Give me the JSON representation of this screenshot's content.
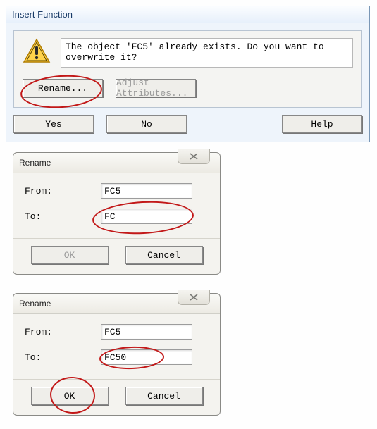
{
  "dialog1": {
    "title": "Insert Function",
    "message": "The object 'FC5' already exists. Do you want to overwrite it?",
    "btn_rename": "Rename...",
    "btn_adjust": "Adjust Attributes...",
    "btn_yes": "Yes",
    "btn_no": "No",
    "btn_help": "Help",
    "icon": "warning-triangle"
  },
  "dialog2": {
    "title": "Rename",
    "from_label": "From:",
    "to_label": "To:",
    "from_value": "FC5",
    "to_value": "FC",
    "btn_ok": "OK",
    "btn_cancel": "Cancel",
    "ok_enabled": false
  },
  "dialog3": {
    "title": "Rename",
    "from_label": "From:",
    "to_label": "To:",
    "from_value": "FC5",
    "to_value": "FC50",
    "btn_ok": "OK",
    "btn_cancel": "Cancel",
    "ok_enabled": true
  }
}
